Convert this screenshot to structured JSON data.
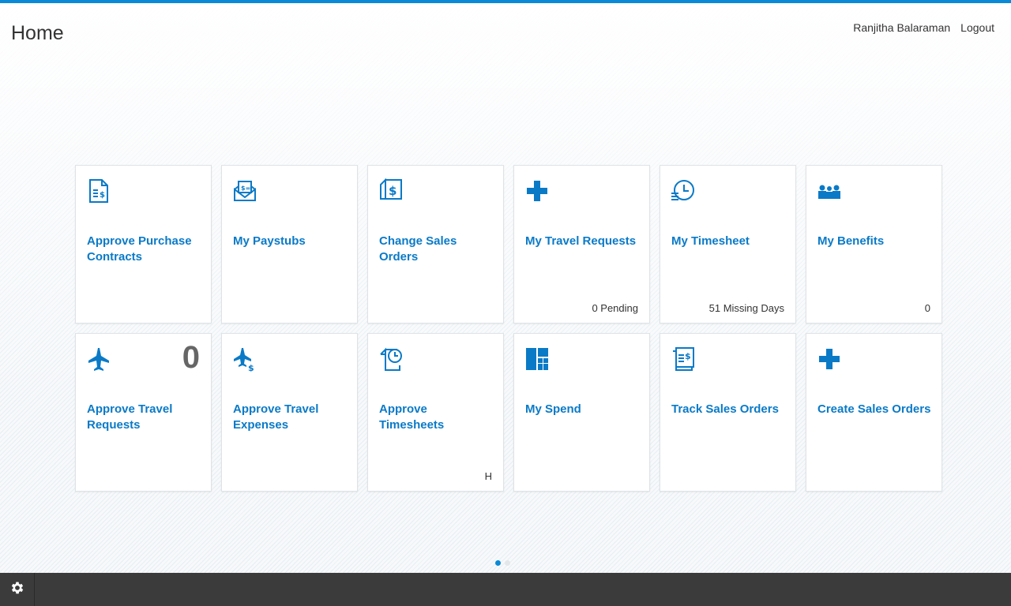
{
  "header": {
    "title": "Home",
    "user_name": "Ranjitha Balaraman",
    "logout_label": "Logout"
  },
  "colors": {
    "accent": "#0a8ad6",
    "tile_title": "#0a7ac7",
    "footer": "#3b3b3b"
  },
  "tiles": [
    {
      "title": "Approve Purchase Contracts",
      "icon": "contract-document-icon",
      "info": ""
    },
    {
      "title": "My Paystubs",
      "icon": "paystub-envelope-icon",
      "info": ""
    },
    {
      "title": "Change Sales Orders",
      "icon": "dollar-document-icon",
      "info": ""
    },
    {
      "title": "My Travel Requests",
      "icon": "plus-icon",
      "info": "0 Pending"
    },
    {
      "title": "My Timesheet",
      "icon": "clock-icon",
      "info": "51 Missing Days"
    },
    {
      "title": "My Benefits",
      "icon": "people-group-icon",
      "info": "0"
    },
    {
      "title": "Approve Travel Requests",
      "icon": "airplane-icon",
      "info": "",
      "number": "0"
    },
    {
      "title": "Approve Travel Expenses",
      "icon": "airplane-dollar-icon",
      "info": ""
    },
    {
      "title": "Approve Timesheets",
      "icon": "document-clock-icon",
      "info": "H"
    },
    {
      "title": "My Spend",
      "icon": "dashboard-blocks-icon",
      "info": ""
    },
    {
      "title": "Track Sales Orders",
      "icon": "sales-order-document-icon",
      "info": ""
    },
    {
      "title": "Create Sales Orders",
      "icon": "plus-icon",
      "info": ""
    }
  ],
  "pager": {
    "pages": 2,
    "active": 1
  },
  "footer": {
    "settings_icon": "gear-icon"
  }
}
